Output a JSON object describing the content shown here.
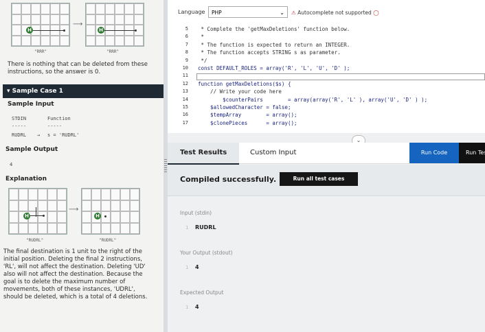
{
  "left": {
    "top_grid": {
      "label_left": "\"RRR\"",
      "label_right": "\"RRR\""
    },
    "explanation_text_1": "There is nothing that can be deleted from these instructions, so the answer is 0.",
    "sample_case_title": "Sample Case 1",
    "sample_input_heading": "Sample Input",
    "stdin_header": "STDIN",
    "function_header": "Function",
    "stdin_dashes": "-----",
    "function_dashes": "-----",
    "stdin_value": "RUDRL",
    "arrow": "→",
    "function_value": "s = 'RUDRL'",
    "sample_output_heading": "Sample Output",
    "sample_output_value": "4",
    "explanation_heading": "Explanation",
    "bottom_grid": {
      "label_left": "\"RUDRL\"",
      "label_right": "\"RUDRL\""
    },
    "explanation_text_2": "The final destination is 1 unit to the right of the initial position. Deleting the final 2 instructions, 'RL', will not affect the destination. Deleting 'UD' also will not affect the destination. Because the goal is to delete the maximum number of movements, both of these instances, 'UDRL', should be deleted, which is a total of 4 deletions."
  },
  "toolbar": {
    "language_label": "Language",
    "language_value": "PHP",
    "warning_text": "Autocomplete not supported"
  },
  "editor": {
    "lines": [
      {
        "n": "5",
        "text": " * Complete the 'getMaxDeletions' function below.",
        "type": "cmt"
      },
      {
        "n": "6",
        "text": " *",
        "type": "cmt"
      },
      {
        "n": "7",
        "text": " * The function is expected to return an INTEGER.",
        "type": "cmt"
      },
      {
        "n": "8",
        "text": " * The function accepts STRING s as parameter.",
        "type": "cmt"
      },
      {
        "n": "9",
        "text": " */",
        "type": "cmt"
      },
      {
        "n": "10",
        "text": "const DEFAULT_ROLES = array('R', 'L', 'U', 'D' );",
        "type": "code"
      },
      {
        "n": "11",
        "text": "",
        "type": "code"
      },
      {
        "n": "12",
        "text": "function getMaxDeletions($s) {",
        "type": "code"
      },
      {
        "n": "13",
        "text": "    // Write your code here",
        "type": "cmt"
      },
      {
        "n": "14",
        "text": "        $counterPairs        = array(array('R', 'L' ), array('U', 'D' ) );",
        "type": "code"
      },
      {
        "n": "15",
        "text": "    $allowedCharacter = false;",
        "type": "code"
      },
      {
        "n": "16",
        "text": "    $tempArray        = array();",
        "type": "code"
      },
      {
        "n": "17",
        "text": "    $clonePieces      = array();",
        "type": "code"
      }
    ]
  },
  "tabs": {
    "test_results": "Test Results",
    "custom_input": "Custom Input",
    "run_code": "Run Code",
    "run_tests": "Run Tests"
  },
  "results": {
    "compiled_message": "Compiled successfully.",
    "run_all_label": "Run all test cases",
    "input_label": "Input (stdin)",
    "input_line_no": "1",
    "input_value": "RUDRL",
    "output_label": "Your Output (stdout)",
    "output_line_no": "1",
    "output_value": "4",
    "expected_label": "Expected Output",
    "expected_line_no": "1",
    "expected_value": "4"
  }
}
